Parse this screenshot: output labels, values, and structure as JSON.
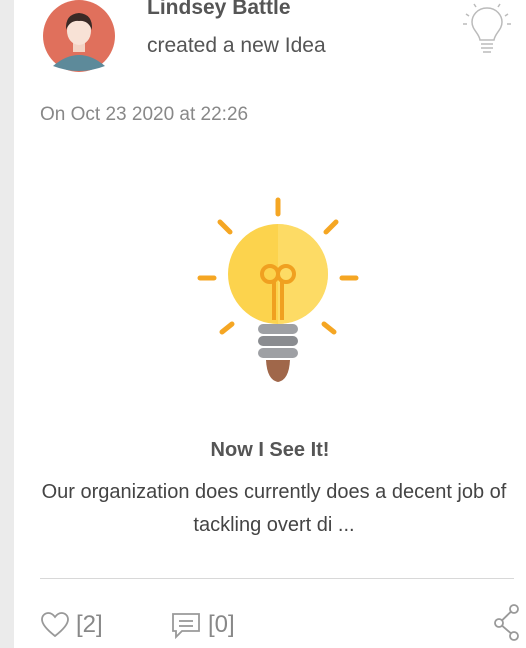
{
  "post": {
    "author_name": "Lindsey Battle",
    "action_text": "created a new Idea",
    "timestamp": "On Oct 23 2020 at 22:26",
    "type_icon": "lightbulb-outline-icon",
    "illustration_icon": "lightbulb-illustration",
    "idea_title": "Now I See It!",
    "idea_description": "Our organization does currently does a decent job of tackling overt di ..."
  },
  "footer": {
    "likes_label": "[2]",
    "comments_label": "[0]",
    "like_icon": "heart-icon",
    "comment_icon": "comment-icon",
    "share_icon": "share-icon"
  },
  "colors": {
    "avatar_bg": "#e0705c",
    "bulb_yellow": "#fcd34d",
    "bulb_rays": "#f5a623",
    "text_gray": "#555555",
    "icon_gray": "#888888"
  }
}
